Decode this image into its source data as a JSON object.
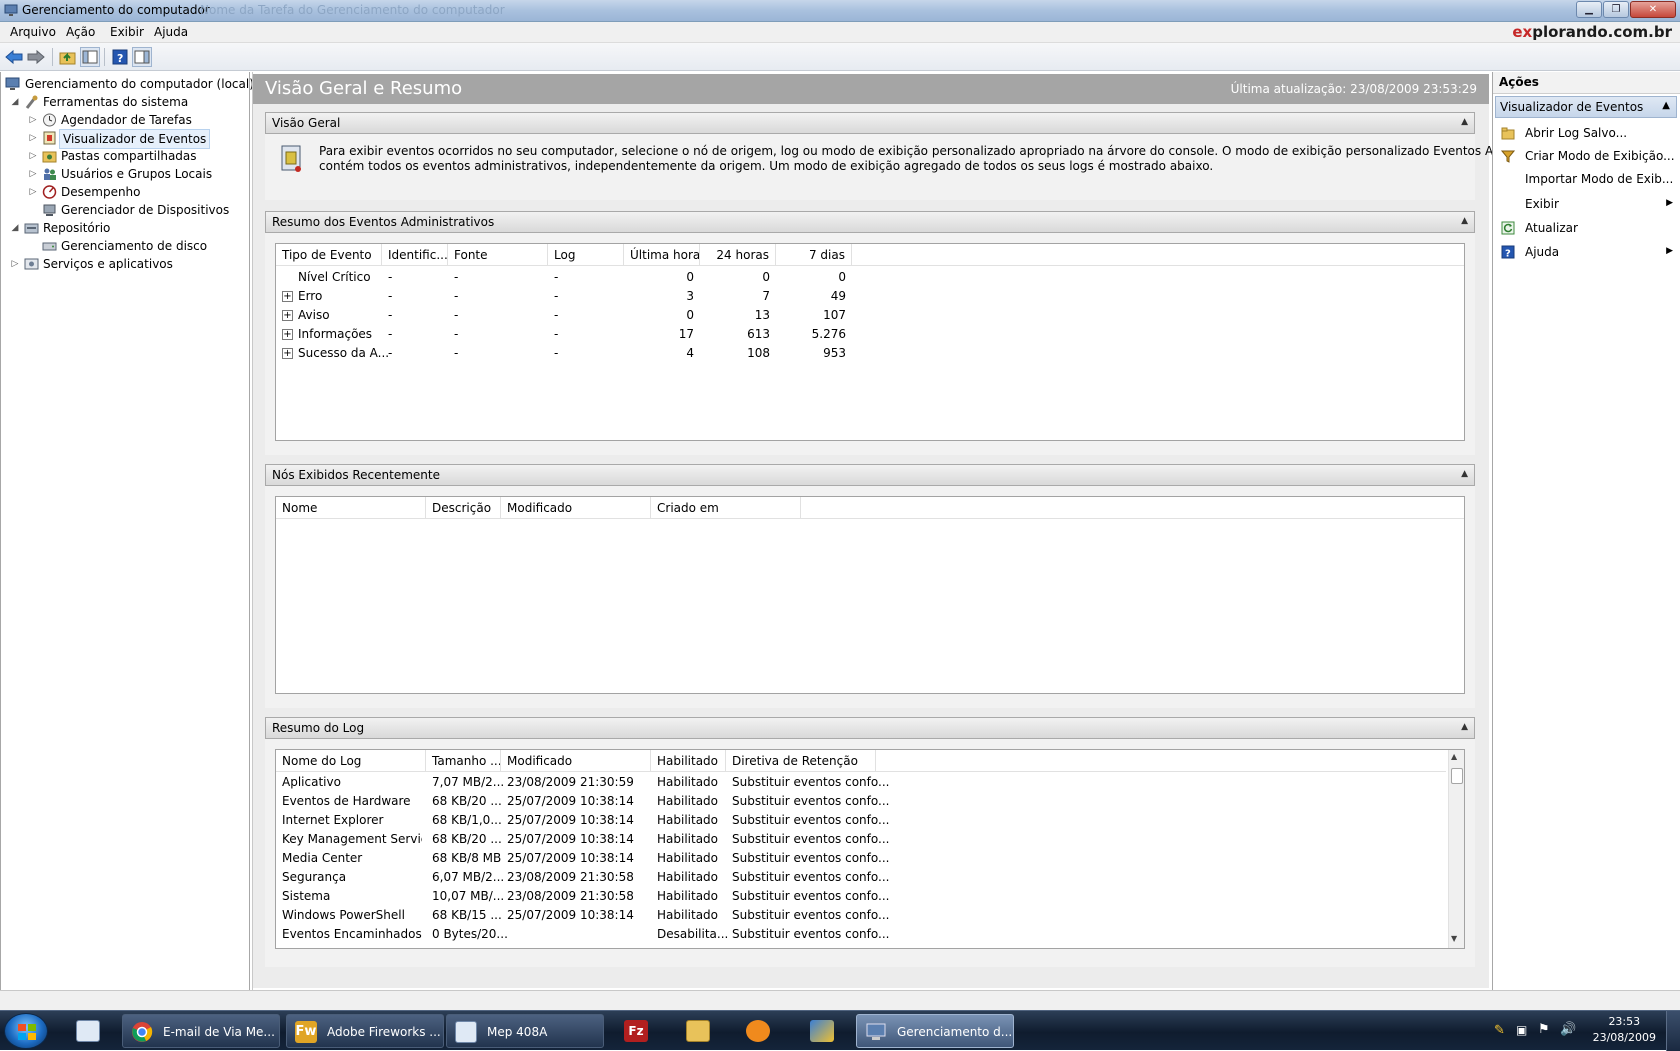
{
  "window": {
    "title": "Gerenciamento do computador",
    "ghost_text": "Nome da Tarefa do Gerenciamento do computador",
    "brand_prefix": "ex",
    "brand_rest": "plorando.com.br",
    "btn_min": "▁",
    "btn_max": "❐",
    "btn_close": "✕"
  },
  "menu": {
    "items": [
      "Arquivo",
      "Ação",
      "Exibir",
      "Ajuda"
    ]
  },
  "toolbar": {
    "icons": [
      "back-arrow-icon",
      "forward-arrow-icon",
      "up-folder-icon",
      "show-hide-tree-icon",
      "help-icon",
      "action-pane-icon"
    ]
  },
  "tree": {
    "root": "Gerenciamento do computador (local)",
    "system_tools": "Ferramentas do sistema",
    "task_scheduler": "Agendador de Tarefas",
    "event_viewer": "Visualizador de Eventos",
    "shared_folders": "Pastas compartilhadas",
    "local_users": "Usuários e Grupos Locais",
    "performance": "Desempenho",
    "device_manager": "Gerenciador de Dispositivos",
    "storage": "Repositório",
    "disk_management": "Gerenciamento de disco",
    "services_apps": "Serviços e aplicativos"
  },
  "center": {
    "title": "Visão Geral e Resumo",
    "updated": "Última atualização: 23/08/2009 23:53:29",
    "overview": {
      "title": "Visão Geral",
      "text1": "Para exibir eventos ocorridos no seu computador, selecione o nó de origem, log ou modo de exibição personalizado apropriado na árvore do console. O modo de exibição personalizado Eventos Administrativos",
      "text2": "contém todos os eventos administrativos, independentemente da origem. Um modo de exibição agregado de todos os seus logs é mostrado abaixo."
    },
    "admin_summary": {
      "title": "Resumo dos Eventos Administrativos",
      "columns": [
        "Tipo de Evento",
        "Identific...",
        "Fonte",
        "Log",
        "Última hora",
        "24 horas",
        "7 dias"
      ],
      "rows": [
        {
          "type": "Nível Crítico",
          "id": "-",
          "source": "-",
          "log": "-",
          "hour": "0",
          "day": "0",
          "week": "0",
          "expandable": false
        },
        {
          "type": "Erro",
          "id": "-",
          "source": "-",
          "log": "-",
          "hour": "3",
          "day": "7",
          "week": "49",
          "expandable": true
        },
        {
          "type": "Aviso",
          "id": "-",
          "source": "-",
          "log": "-",
          "hour": "0",
          "day": "13",
          "week": "107",
          "expandable": true
        },
        {
          "type": "Informações",
          "id": "-",
          "source": "-",
          "log": "-",
          "hour": "17",
          "day": "613",
          "week": "5.276",
          "expandable": true
        },
        {
          "type": "Sucesso da A...",
          "id": "-",
          "source": "-",
          "log": "-",
          "hour": "4",
          "day": "108",
          "week": "953",
          "expandable": true
        }
      ]
    },
    "recent_nodes": {
      "title": "Nós Exibidos Recentemente",
      "columns": [
        "Nome",
        "Descrição",
        "Modificado",
        "Criado em"
      ]
    },
    "log_summary": {
      "title": "Resumo do Log",
      "columns": [
        "Nome do Log",
        "Tamanho ...",
        "Modificado",
        "Habilitado",
        "Diretiva de Retenção"
      ],
      "rows": [
        {
          "name": "Aplicativo",
          "size": "7,07 MB/2...",
          "modified": "23/08/2009 21:30:59",
          "enabled": "Habilitado",
          "policy": "Substituir eventos confo..."
        },
        {
          "name": "Eventos de Hardware",
          "size": "68 KB/20 ...",
          "modified": "25/07/2009 10:38:14",
          "enabled": "Habilitado",
          "policy": "Substituir eventos confo..."
        },
        {
          "name": "Internet Explorer",
          "size": "68 KB/1,0...",
          "modified": "25/07/2009 10:38:14",
          "enabled": "Habilitado",
          "policy": "Substituir eventos confo..."
        },
        {
          "name": "Key Management Service",
          "size": "68 KB/20 ...",
          "modified": "25/07/2009 10:38:14",
          "enabled": "Habilitado",
          "policy": "Substituir eventos confo..."
        },
        {
          "name": "Media Center",
          "size": "68 KB/8 MB",
          "modified": "25/07/2009 10:38:14",
          "enabled": "Habilitado",
          "policy": "Substituir eventos confo..."
        },
        {
          "name": "Segurança",
          "size": "6,07 MB/2...",
          "modified": "23/08/2009 21:30:58",
          "enabled": "Habilitado",
          "policy": "Substituir eventos confo..."
        },
        {
          "name": "Sistema",
          "size": "10,07 MB/...",
          "modified": "23/08/2009 21:30:58",
          "enabled": "Habilitado",
          "policy": "Substituir eventos confo..."
        },
        {
          "name": "Windows PowerShell",
          "size": "68 KB/15 ...",
          "modified": "25/07/2009 10:38:14",
          "enabled": "Habilitado",
          "policy": "Substituir eventos confo..."
        },
        {
          "name": "Eventos Encaminhados",
          "size": "0 Bytes/20...",
          "modified": "",
          "enabled": "Desabilita...",
          "policy": "Substituir eventos confo..."
        }
      ]
    }
  },
  "actions": {
    "title": "Ações",
    "group": "Visualizador de Eventos",
    "open_log": "Abrir Log Salvo...",
    "create_view": "Criar Modo de Exibição...",
    "import_view": "Importar Modo de Exib...",
    "view": "Exibir",
    "refresh": "Atualizar",
    "help": "Ajuda"
  },
  "taskbar": {
    "tasks": [
      {
        "label": "E-mail de Via Me...",
        "icon": "chrome-icon"
      },
      {
        "label": "Adobe Fireworks ...",
        "icon": "fireworks-icon"
      },
      {
        "label": "Mep 408A",
        "icon": "notepad-icon"
      },
      {
        "label": "Gerenciamento d...",
        "icon": "computer-management-icon"
      }
    ],
    "fw_glyph": "Fw",
    "fz_glyph": "Fz",
    "clock_time": "23:53",
    "clock_date": "23/08/2009"
  },
  "colors": {
    "header_gray": "#a5a5a5",
    "section_bg": "#ececec",
    "brand_red": "#c62828"
  }
}
